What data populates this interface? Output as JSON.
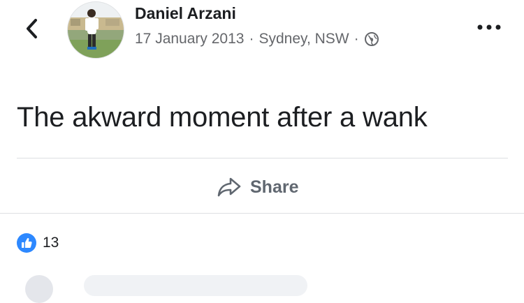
{
  "post": {
    "author": "Daniel Arzani",
    "date": "17 January 2013",
    "separator": "·",
    "location": "Sydney, NSW",
    "privacy_icon": "globe-icon",
    "text": "The akward moment after a wank"
  },
  "actions": {
    "share_label": "Share",
    "share_icon": "share-arrow-icon"
  },
  "reactions": {
    "like_count": "13",
    "like_icon": "thumbs-up-icon"
  },
  "colors": {
    "like_blue": "#2d88ff",
    "text_primary": "#1c1e21",
    "text_secondary": "#65676b",
    "divider": "#dddfe2"
  }
}
